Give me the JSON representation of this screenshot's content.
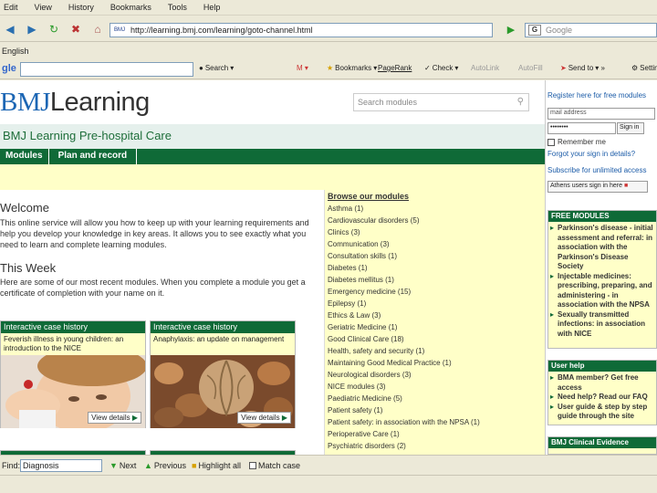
{
  "menu": [
    "Edit",
    "View",
    "History",
    "Bookmarks",
    "Tools",
    "Help"
  ],
  "address": {
    "favicon": "BMJ",
    "url": "http://learning.bmj.com/learning/goto-channel.html"
  },
  "search_engine": {
    "placeholder": "Google"
  },
  "language_bar": "English",
  "google_toolbar": {
    "logo": "gle",
    "items": [
      "Search",
      "Bookmarks",
      "PageRank",
      "Check",
      "AutoLink",
      "AutoFill",
      "Send to",
      "Settings"
    ]
  },
  "header": {
    "logo_bmj": "BMJ",
    "logo_learning": "Learning",
    "search_placeholder": "Search modules",
    "channel_title": "BMJ Learning Pre-hospital Care"
  },
  "tabs": [
    "Modules",
    "Plan and record"
  ],
  "welcome": {
    "title": "Welcome",
    "text": "This online service will allow you how to keep up with your learning requirements and help you develop your knowledge in key areas. It allows you to see exactly what you need to learn and complete learning modules."
  },
  "this_week": {
    "title": "This Week",
    "text": "Here are some of our most recent modules. When you complete a module you get a certificate of completion with your name on it."
  },
  "cards": [
    {
      "head": "Interactive case history",
      "sub": "Feverish illness in young children: an introduction to the NICE",
      "button": "View details"
    },
    {
      "head": "Interactive case history",
      "sub": "Anaphylaxis: an update on management",
      "button": "View details"
    }
  ],
  "browse": {
    "title": "Browse our modules",
    "items": [
      "Asthma (1)",
      "Cardiovascular disorders (5)",
      "Clinics (3)",
      "Communication (3)",
      "Consultation skills (1)",
      "Diabetes (1)",
      "Diabetes mellitus (1)",
      "Emergency medicine (15)",
      "Epilepsy (1)",
      "Ethics & Law (3)",
      "Geriatric Medicine (1)",
      "Good Clinical Care (18)",
      "Health, safety and security (1)",
      "Maintaining Good Medical Practice (1)",
      "Neurological disorders (3)",
      "NICE modules (3)",
      "Paediatric Medicine (5)",
      "Patient safety (1)",
      "Patient safety: in association with the NPSA (1)",
      "Perioperative Care (1)",
      "Psychiatric disorders (2)"
    ]
  },
  "sidebar": {
    "register_link": "Register here for free modules",
    "email_placeholder": "mail address",
    "password_value": "••••••••",
    "signin_button": "Sign in",
    "remember_label": "Remember me",
    "forgot_link": "Forgot your sign in details?",
    "subscribe_link": "Subscribe for unlimited access",
    "athens_button": "Athens users sign in here",
    "free_modules_title": "FREE MODULES",
    "free_modules": [
      "Parkinson's disease - initial assessment and referral: in association with the Parkinson's Disease Society",
      "Injectable medicines: prescribing, preparing, and administering - in association with the NPSA",
      "Sexually transmitted infections: in association with NICE"
    ],
    "user_help_title": "User help",
    "user_help": [
      "BMA member? Get free access",
      "Need help? Read our FAQ",
      "User guide & step by step guide through the site"
    ],
    "evidence_title": "BMJ Clinical Evidence"
  },
  "findbar": {
    "label": "Find:",
    "value": "Diagnosis",
    "next": "Next",
    "previous": "Previous",
    "highlight": "Highlight all",
    "match_case": "Match case"
  }
}
